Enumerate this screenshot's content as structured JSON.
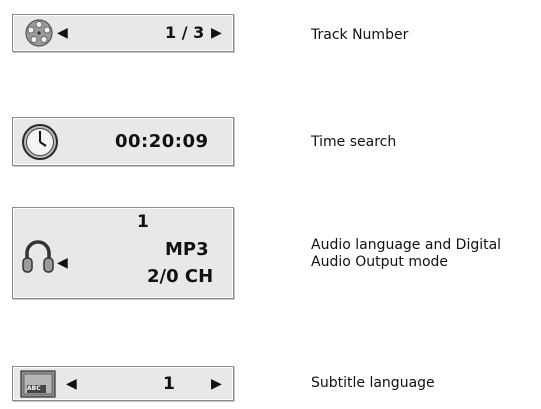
{
  "osd": {
    "track": {
      "icon": "film-reel-icon",
      "left_arrow": "◀",
      "value": "1 / 3",
      "right_arrow": "▶",
      "caption": "Track Number"
    },
    "time": {
      "icon": "clock-icon",
      "value": "00:20:09",
      "caption": "Time search"
    },
    "audio": {
      "icon": "headphones-icon",
      "left_arrow": "◀",
      "line1": "1",
      "line2": "MP3",
      "line3": "2/0 CH",
      "caption_line1": "Audio language and Digital",
      "caption_line2": "Audio Output mode"
    },
    "subtitle": {
      "icon": "subtitle-abc-icon",
      "icon_text": "ABC",
      "left_arrow": "◀",
      "value": "1",
      "right_arrow": "▶",
      "caption": "Subtitle language"
    }
  }
}
